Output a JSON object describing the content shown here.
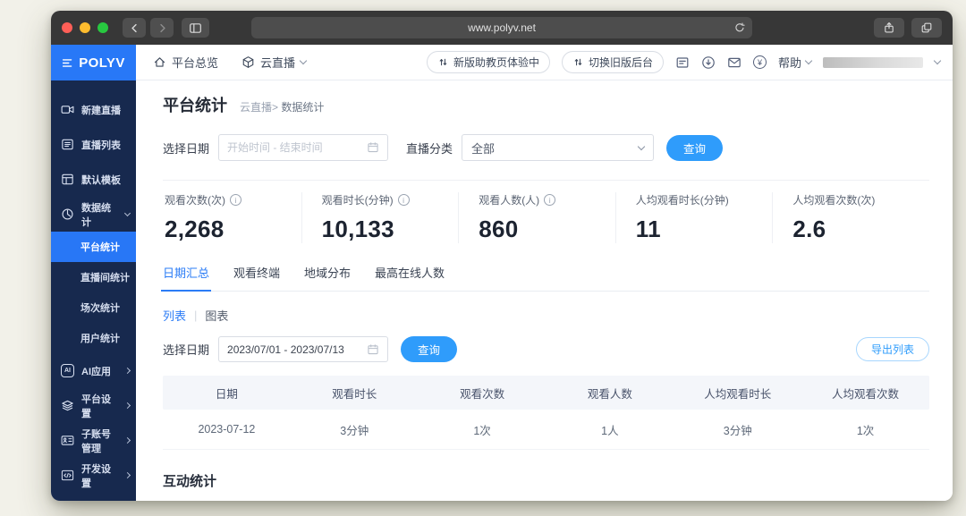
{
  "browser": {
    "url": "www.polyv.net"
  },
  "brand": {
    "name": "POLYV"
  },
  "header": {
    "nav_overview": "平台总览",
    "nav_cloud_live": "云直播",
    "pill_new_version": "新版助教页体验中",
    "pill_switch_old": "切换旧版后台",
    "help": "帮助"
  },
  "sidebar": {
    "items": [
      {
        "label": "新建直播",
        "icon": "video-camera-icon"
      },
      {
        "label": "直播列表",
        "icon": "list-icon"
      },
      {
        "label": "默认模板",
        "icon": "template-icon"
      },
      {
        "label": "数据统计",
        "icon": "pie-chart-icon",
        "expanded": true
      }
    ],
    "sub_items": [
      {
        "label": "平台统计",
        "active": true
      },
      {
        "label": "直播间统计",
        "active": false
      },
      {
        "label": "场次统计",
        "active": false
      },
      {
        "label": "用户统计",
        "active": false
      }
    ],
    "bottom_items": [
      {
        "label": "AI应用",
        "icon": "ai-icon"
      },
      {
        "label": "平台设置",
        "icon": "layers-icon"
      },
      {
        "label": "子账号管理",
        "icon": "id-card-icon"
      },
      {
        "label": "开发设置",
        "icon": "code-icon"
      }
    ]
  },
  "page": {
    "title": "平台统计",
    "breadcrumb_parent": "云直播",
    "breadcrumb_sep": ">",
    "breadcrumb_current": "数据统计",
    "section_interaction": "互动统计"
  },
  "filters": {
    "date_label": "选择日期",
    "date_placeholder": "开始时间 - 结束时间",
    "category_label": "直播分类",
    "category_value": "全部",
    "query": "查询"
  },
  "stats": [
    {
      "label": "观看次数(次)",
      "info": true,
      "value": "2,268"
    },
    {
      "label": "观看时长(分钟)",
      "info": true,
      "value": "10,133"
    },
    {
      "label": "观看人数(人)",
      "info": true,
      "value": "860"
    },
    {
      "label": "人均观看时长(分钟)",
      "info": false,
      "value": "11"
    },
    {
      "label": "人均观看次数(次)",
      "info": false,
      "value": "2.6"
    }
  ],
  "tabs": [
    {
      "label": "日期汇总",
      "active": true
    },
    {
      "label": "观看终端",
      "active": false
    },
    {
      "label": "地域分布",
      "active": false
    },
    {
      "label": "最高在线人数",
      "active": false
    }
  ],
  "view_toggle": {
    "list": "列表",
    "sep": "|",
    "chart": "图表"
  },
  "list_filter": {
    "date_label": "选择日期",
    "date_value": "2023/07/01 - 2023/07/13",
    "query": "查询",
    "export": "导出列表"
  },
  "table": {
    "headers": [
      "日期",
      "观看时长",
      "观看次数",
      "观看人数",
      "人均观看时长",
      "人均观看次数"
    ],
    "rows": [
      [
        "2023-07-12",
        "3分钟",
        "1次",
        "1人",
        "3分钟",
        "1次"
      ]
    ]
  },
  "glyphs": {
    "info": "i",
    "ai": "AI",
    "yen": "¥"
  },
  "colors": {
    "brand_blue": "#2878f7",
    "link_blue": "#2b7cf6",
    "button_blue": "#2f9cfb",
    "sidebar_navy": "#17294e",
    "chrome_gray": "#373737"
  },
  "icons": [
    "hamburger-icon",
    "home-icon",
    "cube-icon",
    "sort-arrows-icon",
    "news-icon",
    "download-icon",
    "mail-icon",
    "billing-icon",
    "calendar-icon",
    "info-icon",
    "reload-icon",
    "share-icon",
    "tabs-overview-icon",
    "sidebar-toggle-icon",
    "back-icon",
    "forward-icon"
  ]
}
